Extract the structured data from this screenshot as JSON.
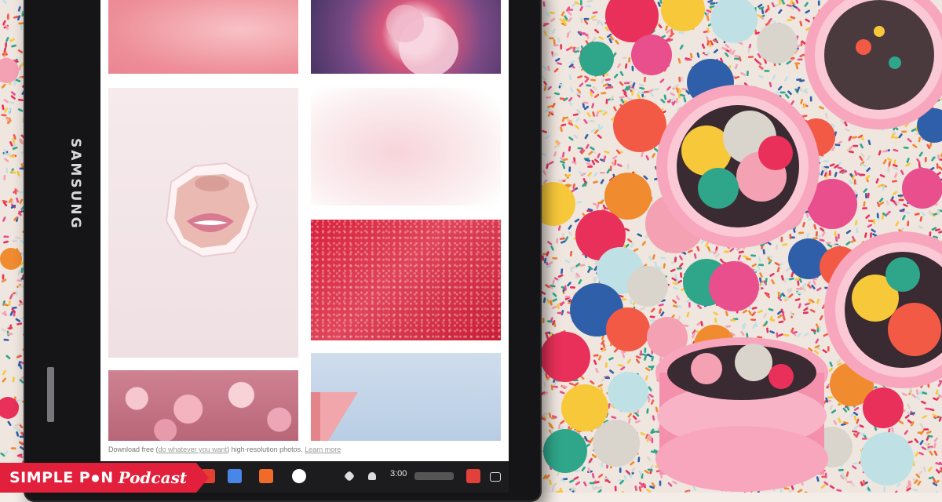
{
  "device": {
    "brand": "SAMSUNG"
  },
  "screen": {
    "footer": {
      "prefix": "Download free (",
      "link1": "do whatever you want",
      "middle": ") high-resolution photos.",
      "link2": "Learn more"
    }
  },
  "shelf": {
    "time": "3:00"
  },
  "logo": {
    "part1": "SIMPLE P",
    "pin": "●",
    "part2": "N",
    "part3": "Podcast"
  },
  "colors": {
    "brand_red": "#e3203b",
    "confetti": [
      "#e8305a",
      "#f25a45",
      "#2fa58a",
      "#f7c83a",
      "#f5a1b4",
      "#e94f8c",
      "#bfe1e6",
      "#f08b2f",
      "#2f5fa8",
      "#d9d4cc"
    ]
  }
}
